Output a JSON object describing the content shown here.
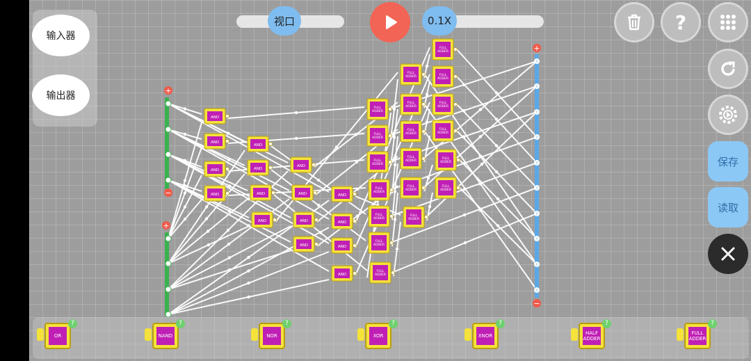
{
  "left_panel": {
    "input_label": "输入器",
    "output_label": "输出器"
  },
  "top_bar": {
    "viewport_label": "视口",
    "speed_label": "0.1X"
  },
  "right_controls": {
    "delete_icon": "trash-icon",
    "help_label": "?",
    "grid_icon": "grid-icon",
    "reset_icon": "refresh-icon",
    "settings_icon": "gear-icon",
    "save_label": "保存",
    "load_label": "读取",
    "close_icon": "close-icon"
  },
  "palette": [
    {
      "label": "OR",
      "help": "?"
    },
    {
      "label": "NAND",
      "help": "?"
    },
    {
      "label": "NOR",
      "help": "?"
    },
    {
      "label": "XOR",
      "help": "?"
    },
    {
      "label": "XNOR",
      "help": "?"
    },
    {
      "label": "HALF ADDER",
      "help": "?"
    },
    {
      "label": "FULL ADDER",
      "help": "?"
    }
  ],
  "circuit": {
    "and_label": "AND",
    "full_adder_label": "FULL ADDER",
    "plus": "+",
    "minus": "−",
    "pin": "?"
  },
  "colors": {
    "accent_blue": "#7fbcef",
    "play_red": "#f26455",
    "gate_yellow": "#f5e23a",
    "gate_magenta": "#c01fb5",
    "input_green": "#3ab14f",
    "output_blue": "#5aa8e8"
  }
}
